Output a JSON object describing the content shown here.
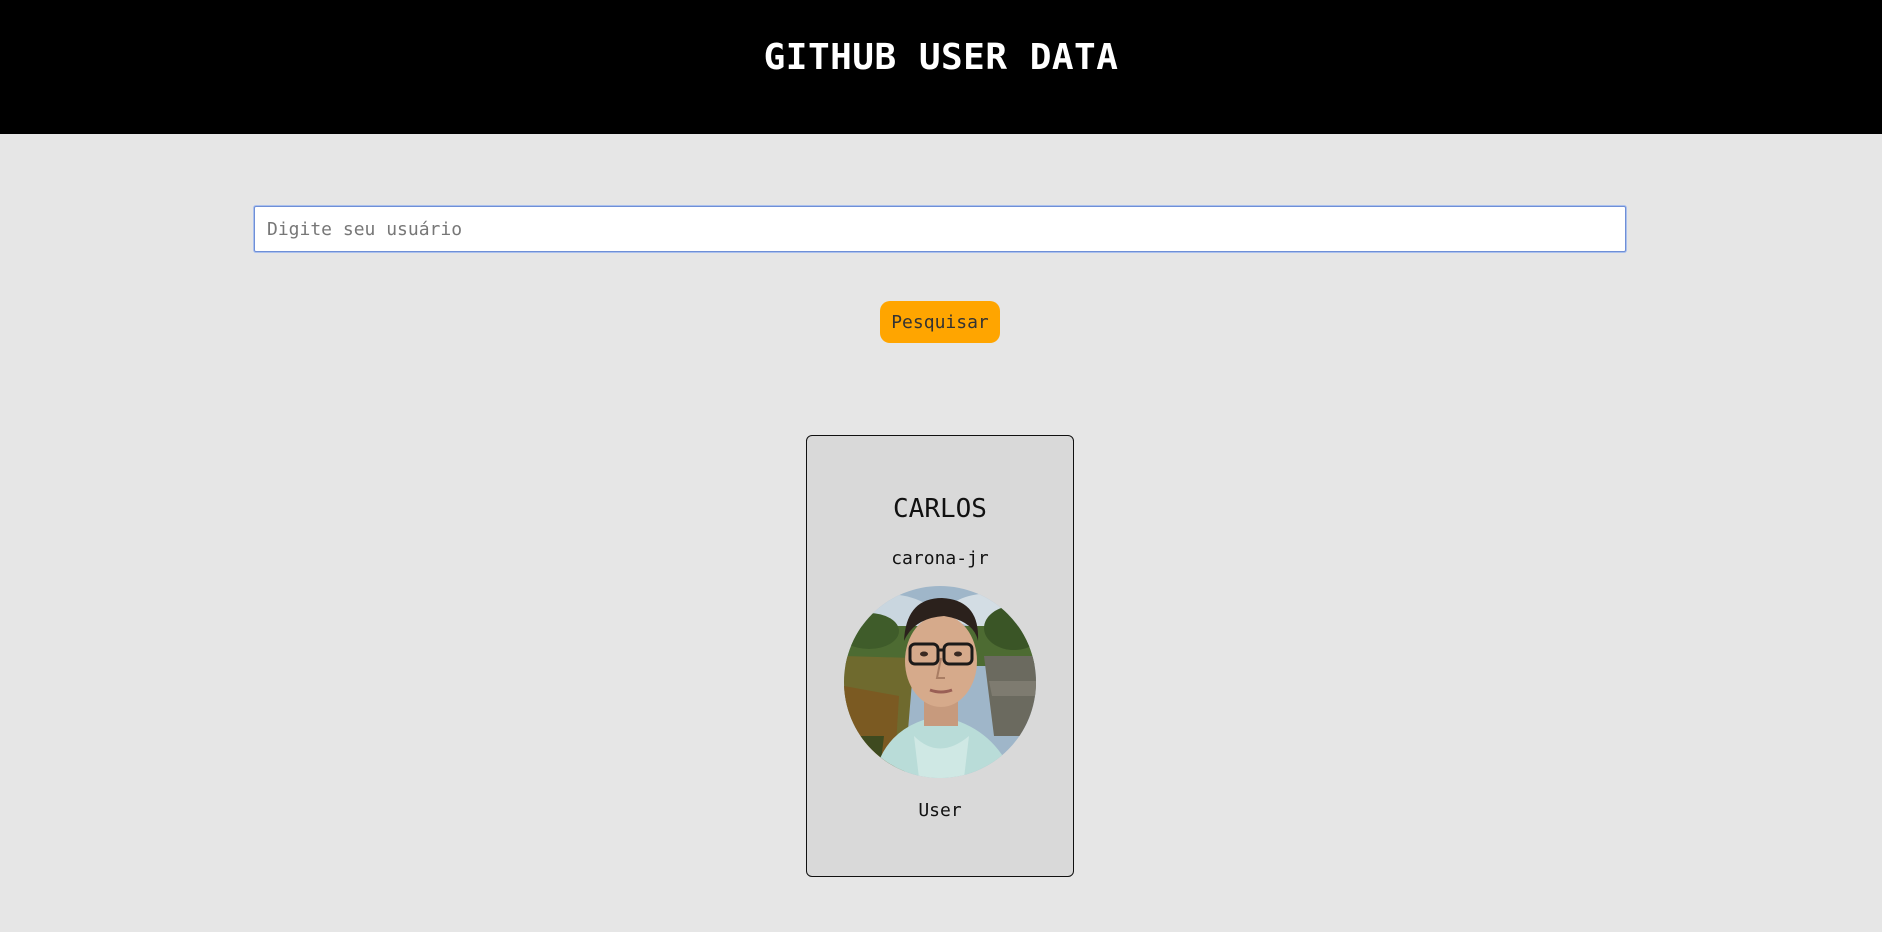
{
  "header": {
    "title": "GITHUB USER DATA"
  },
  "search": {
    "placeholder": "Digite seu usuário",
    "value": "",
    "button_label": "Pesquisar"
  },
  "user_card": {
    "name": "CARLOS",
    "login": "carona-jr",
    "type": "User"
  },
  "colors": {
    "header_bg": "#000000",
    "page_bg": "#e6e6e6",
    "button_bg": "#ffa500",
    "card_bg": "#d9d9d9"
  }
}
